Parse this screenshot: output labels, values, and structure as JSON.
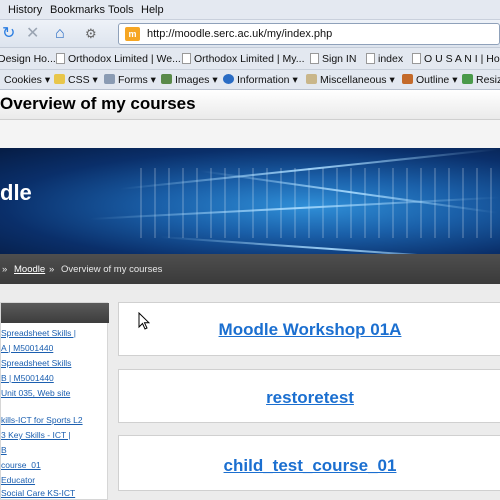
{
  "browser": {
    "menu": [
      "History",
      "Bookmarks",
      "Tools",
      "Help"
    ],
    "url": "http://moodle.serc.ac.uk/my/index.php",
    "favicon_text": "m",
    "bookmarks": [
      "Design Ho...",
      "Orthodox Limited | We...",
      "Orthodox Limited | My...",
      "Sign IN",
      "index",
      "O U S A N I | Hon"
    ],
    "devtools": [
      "Cookies",
      "CSS",
      "Forms",
      "Images",
      "Information",
      "Miscellaneous",
      "Outline",
      "Resiz"
    ]
  },
  "page": {
    "title": "Overview of my courses",
    "logo_text": "dle",
    "breadcrumb": {
      "sep1": "»",
      "link": "Moodle",
      "sep2": "»",
      "current": "Overview of my courses"
    }
  },
  "sidebar": {
    "links": [
      "Spreadsheet Skills |",
      "A | M5001440",
      "Spreadsheet Skills",
      "B | M5001440",
      "Unit 035, Web site",
      "kills-ICT for Sports L2",
      "3 Key Skills - ICT |",
      "B",
      "course_01",
      "Educator",
      "Social Care KS-ICT"
    ]
  },
  "courses": [
    {
      "name": "Moodle Workshop 01A"
    },
    {
      "name": "restoretest"
    },
    {
      "name": "child_test_course_01"
    }
  ],
  "colors": {
    "link": "#1b6fd0",
    "banner": "#1a5fa8",
    "breadcrumb_bg": "#444444"
  }
}
